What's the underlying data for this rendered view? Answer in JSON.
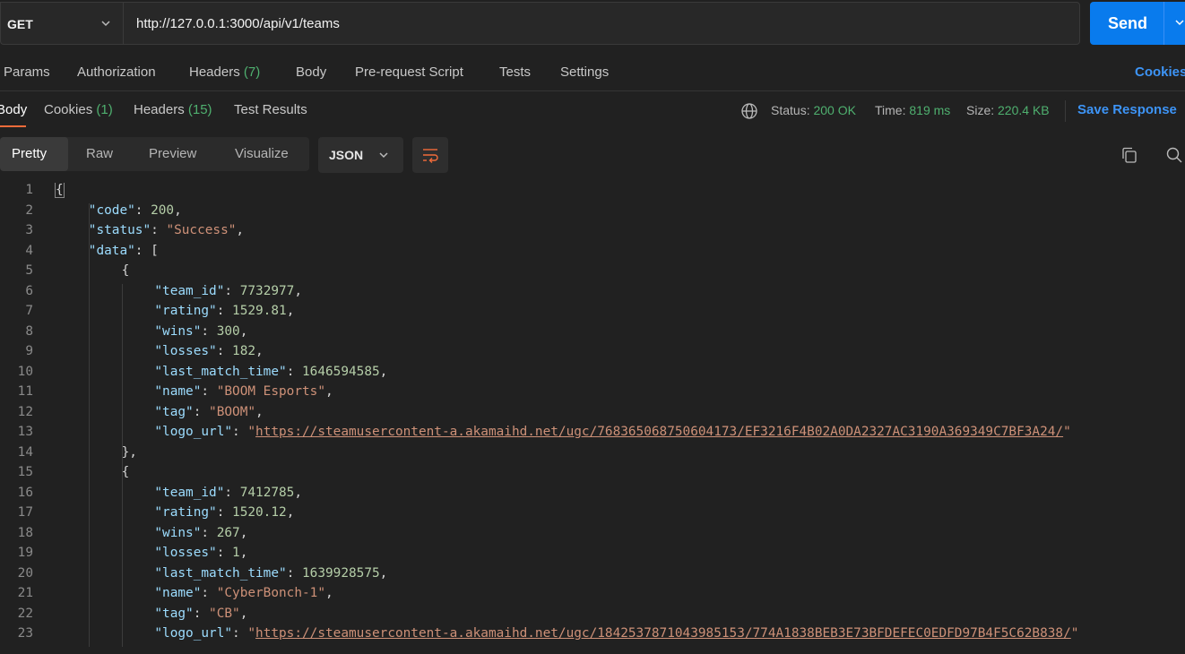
{
  "request": {
    "method": "GET",
    "url": "http://127.0.0.1:3000/api/v1/teams",
    "send_label": "Send"
  },
  "request_tabs": {
    "params": "Params",
    "authorization": "Authorization",
    "headers": "Headers",
    "headers_count": "(7)",
    "body": "Body",
    "prerequest": "Pre-request Script",
    "tests": "Tests",
    "settings": "Settings",
    "cookies": "Cookies"
  },
  "response_tabs": {
    "body": "Body",
    "cookies": "Cookies",
    "cookies_count": "(1)",
    "headers": "Headers",
    "headers_count": "(15)",
    "test_results": "Test Results"
  },
  "response_meta": {
    "status_label": "Status:",
    "status_value": "200 OK",
    "time_label": "Time:",
    "time_value": "819 ms",
    "size_label": "Size:",
    "size_value": "220.4 KB",
    "save_response": "Save Response"
  },
  "format_toolbar": {
    "pretty": "Pretty",
    "raw": "Raw",
    "preview": "Preview",
    "visualize": "Visualize",
    "language": "JSON"
  },
  "code_lines": [
    {
      "num": "1",
      "indent": 0,
      "tokens": [
        {
          "t": "{",
          "c": "p"
        }
      ]
    },
    {
      "num": "2",
      "indent": 1,
      "tokens": [
        {
          "t": "\"code\"",
          "c": "k"
        },
        {
          "t": ": ",
          "c": "p"
        },
        {
          "t": "200",
          "c": "n"
        },
        {
          "t": ",",
          "c": "p"
        }
      ]
    },
    {
      "num": "3",
      "indent": 1,
      "tokens": [
        {
          "t": "\"status\"",
          "c": "k"
        },
        {
          "t": ": ",
          "c": "p"
        },
        {
          "t": "\"Success\"",
          "c": "s"
        },
        {
          "t": ",",
          "c": "p"
        }
      ]
    },
    {
      "num": "4",
      "indent": 1,
      "tokens": [
        {
          "t": "\"data\"",
          "c": "k"
        },
        {
          "t": ": [",
          "c": "p"
        }
      ]
    },
    {
      "num": "5",
      "indent": 2,
      "tokens": [
        {
          "t": "{",
          "c": "p"
        }
      ]
    },
    {
      "num": "6",
      "indent": 3,
      "tokens": [
        {
          "t": "\"team_id\"",
          "c": "k"
        },
        {
          "t": ": ",
          "c": "p"
        },
        {
          "t": "7732977",
          "c": "n"
        },
        {
          "t": ",",
          "c": "p"
        }
      ]
    },
    {
      "num": "7",
      "indent": 3,
      "tokens": [
        {
          "t": "\"rating\"",
          "c": "k"
        },
        {
          "t": ": ",
          "c": "p"
        },
        {
          "t": "1529.81",
          "c": "n"
        },
        {
          "t": ",",
          "c": "p"
        }
      ]
    },
    {
      "num": "8",
      "indent": 3,
      "tokens": [
        {
          "t": "\"wins\"",
          "c": "k"
        },
        {
          "t": ": ",
          "c": "p"
        },
        {
          "t": "300",
          "c": "n"
        },
        {
          "t": ",",
          "c": "p"
        }
      ]
    },
    {
      "num": "9",
      "indent": 3,
      "tokens": [
        {
          "t": "\"losses\"",
          "c": "k"
        },
        {
          "t": ": ",
          "c": "p"
        },
        {
          "t": "182",
          "c": "n"
        },
        {
          "t": ",",
          "c": "p"
        }
      ]
    },
    {
      "num": "10",
      "indent": 3,
      "tokens": [
        {
          "t": "\"last_match_time\"",
          "c": "k"
        },
        {
          "t": ": ",
          "c": "p"
        },
        {
          "t": "1646594585",
          "c": "n"
        },
        {
          "t": ",",
          "c": "p"
        }
      ]
    },
    {
      "num": "11",
      "indent": 3,
      "tokens": [
        {
          "t": "\"name\"",
          "c": "k"
        },
        {
          "t": ": ",
          "c": "p"
        },
        {
          "t": "\"BOOM Esports\"",
          "c": "s"
        },
        {
          "t": ",",
          "c": "p"
        }
      ]
    },
    {
      "num": "12",
      "indent": 3,
      "tokens": [
        {
          "t": "\"tag\"",
          "c": "k"
        },
        {
          "t": ": ",
          "c": "p"
        },
        {
          "t": "\"BOOM\"",
          "c": "s"
        },
        {
          "t": ",",
          "c": "p"
        }
      ]
    },
    {
      "num": "13",
      "indent": 3,
      "tokens": [
        {
          "t": "\"logo_url\"",
          "c": "k"
        },
        {
          "t": ": ",
          "c": "p"
        },
        {
          "t": "\"",
          "c": "s"
        },
        {
          "t": "https://steamusercontent-a.akamaihd.net/ugc/768365068750604173/EF3216F4B02A0DA2327AC3190A369349C7BF3A24/",
          "c": "u"
        },
        {
          "t": "\"",
          "c": "s"
        }
      ]
    },
    {
      "num": "14",
      "indent": 2,
      "tokens": [
        {
          "t": "}",
          "c": "p"
        },
        {
          "t": ",",
          "c": "p"
        }
      ]
    },
    {
      "num": "15",
      "indent": 2,
      "tokens": [
        {
          "t": "{",
          "c": "p"
        }
      ]
    },
    {
      "num": "16",
      "indent": 3,
      "tokens": [
        {
          "t": "\"team_id\"",
          "c": "k"
        },
        {
          "t": ": ",
          "c": "p"
        },
        {
          "t": "7412785",
          "c": "n"
        },
        {
          "t": ",",
          "c": "p"
        }
      ]
    },
    {
      "num": "17",
      "indent": 3,
      "tokens": [
        {
          "t": "\"rating\"",
          "c": "k"
        },
        {
          "t": ": ",
          "c": "p"
        },
        {
          "t": "1520.12",
          "c": "n"
        },
        {
          "t": ",",
          "c": "p"
        }
      ]
    },
    {
      "num": "18",
      "indent": 3,
      "tokens": [
        {
          "t": "\"wins\"",
          "c": "k"
        },
        {
          "t": ": ",
          "c": "p"
        },
        {
          "t": "267",
          "c": "n"
        },
        {
          "t": ",",
          "c": "p"
        }
      ]
    },
    {
      "num": "19",
      "indent": 3,
      "tokens": [
        {
          "t": "\"losses\"",
          "c": "k"
        },
        {
          "t": ": ",
          "c": "p"
        },
        {
          "t": "1",
          "c": "n"
        },
        {
          "t": ",",
          "c": "p"
        }
      ]
    },
    {
      "num": "20",
      "indent": 3,
      "tokens": [
        {
          "t": "\"last_match_time\"",
          "c": "k"
        },
        {
          "t": ": ",
          "c": "p"
        },
        {
          "t": "1639928575",
          "c": "n"
        },
        {
          "t": ",",
          "c": "p"
        }
      ]
    },
    {
      "num": "21",
      "indent": 3,
      "tokens": [
        {
          "t": "\"name\"",
          "c": "k"
        },
        {
          "t": ": ",
          "c": "p"
        },
        {
          "t": "\"CyberBonch-1\"",
          "c": "s"
        },
        {
          "t": ",",
          "c": "p"
        }
      ]
    },
    {
      "num": "22",
      "indent": 3,
      "tokens": [
        {
          "t": "\"tag\"",
          "c": "k"
        },
        {
          "t": ": ",
          "c": "p"
        },
        {
          "t": "\"CB\"",
          "c": "s"
        },
        {
          "t": ",",
          "c": "p"
        }
      ]
    },
    {
      "num": "23",
      "indent": 3,
      "tokens": [
        {
          "t": "\"logo_url\"",
          "c": "k"
        },
        {
          "t": ": ",
          "c": "p"
        },
        {
          "t": "\"",
          "c": "s"
        },
        {
          "t": "https://steamusercontent-a.akamaihd.net/ugc/1842537871043985153/774A1838BEB3E73BFDEFEC0EDFD97B4F5C62B838/",
          "c": "u"
        },
        {
          "t": "\"",
          "c": "s"
        }
      ]
    }
  ]
}
